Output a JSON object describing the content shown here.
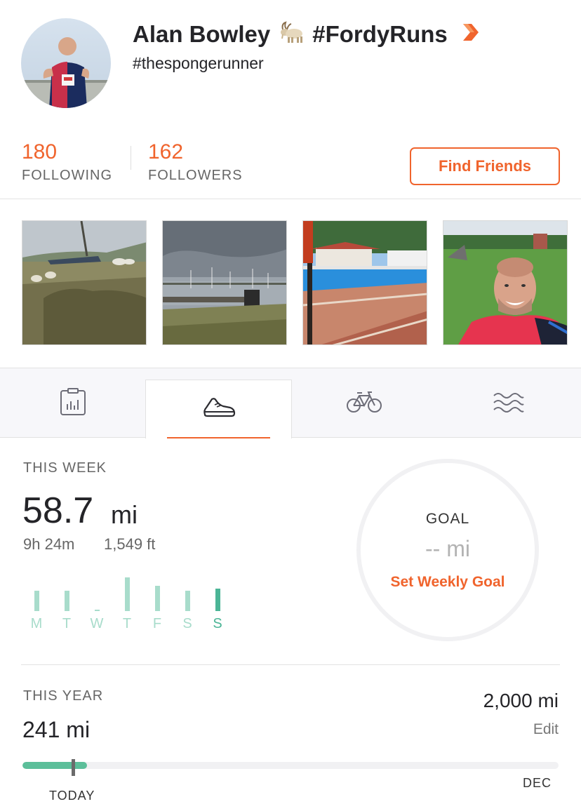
{
  "profile": {
    "name": "Alan Bowley",
    "name_emoji": "goat-emoji",
    "name_tag": "#FordyRuns",
    "handle": "#thespongerunner",
    "badge_icon": "orange-chevron-icon"
  },
  "stats": {
    "following_count": "180",
    "following_label": "FOLLOWING",
    "followers_count": "162",
    "followers_label": "FOLLOWERS",
    "find_friends_label": "Find Friends"
  },
  "photos": [
    {
      "subject": "sheep grazing on grassy bank with boats"
    },
    {
      "subject": "harbour with moored boats under grey sky"
    },
    {
      "subject": "outdoor swimming pool with terrace"
    },
    {
      "subject": "selfie of runner in park"
    }
  ],
  "tabs": [
    {
      "icon": "activity-log-icon",
      "active": false
    },
    {
      "icon": "running-shoe-icon",
      "active": true
    },
    {
      "icon": "bicycle-icon",
      "active": false
    },
    {
      "icon": "swimming-waves-icon",
      "active": false
    }
  ],
  "this_week": {
    "label": "THIS WEEK",
    "distance": "58.7",
    "distance_unit": "mi",
    "time": "9h 24m",
    "elevation": "1,549 ft",
    "days": [
      {
        "label": "M",
        "level": 0.6,
        "today": false
      },
      {
        "label": "T",
        "level": 0.6,
        "today": false
      },
      {
        "label": "W",
        "level": 0.04,
        "today": false
      },
      {
        "label": "T",
        "level": 1.0,
        "today": false
      },
      {
        "label": "F",
        "level": 0.75,
        "today": false
      },
      {
        "label": "S",
        "level": 0.6,
        "today": false
      },
      {
        "label": "S",
        "level": 0.67,
        "today": true
      }
    ]
  },
  "goal": {
    "title": "GOAL",
    "value": "-- mi",
    "set_label": "Set Weekly Goal"
  },
  "this_year": {
    "label": "THIS YEAR",
    "distance": "241 mi",
    "goal": "2,000 mi",
    "edit_label": "Edit",
    "progress": 0.12,
    "today_position": 0.092,
    "today_label": "TODAY",
    "end_label": "DEC"
  },
  "colors": {
    "accent": "#f0642d",
    "bar": "#a8dccb",
    "bar_today": "#4bb596",
    "progress": "#5cbf9a"
  }
}
